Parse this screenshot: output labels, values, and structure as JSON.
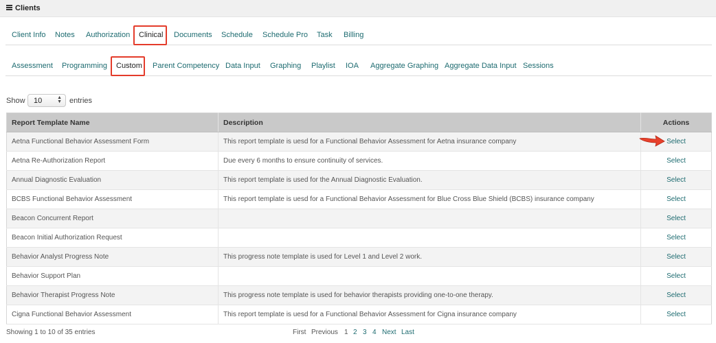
{
  "header": {
    "title": "Clients",
    "menu_icon": "hamburger-icon"
  },
  "main_tabs": [
    {
      "label": "Client Info"
    },
    {
      "label": "Notes"
    },
    {
      "label": "Authorization"
    },
    {
      "label": "Clinical",
      "active": true
    },
    {
      "label": "Documents"
    },
    {
      "label": "Schedule"
    },
    {
      "label": "Schedule Pro"
    },
    {
      "label": "Task"
    },
    {
      "label": "Billing"
    }
  ],
  "sub_tabs": [
    {
      "label": "Assessment"
    },
    {
      "label": "Programming"
    },
    {
      "label": "Custom",
      "active": true
    },
    {
      "label": "Parent Competency"
    },
    {
      "label": "Data Input"
    },
    {
      "label": "Graphing"
    },
    {
      "label": "Playlist"
    },
    {
      "label": "IOA"
    },
    {
      "label": "Aggregate Graphing"
    },
    {
      "label": "Aggregate Data Input"
    },
    {
      "label": "Sessions"
    }
  ],
  "length_control": {
    "show_label": "Show",
    "value": "10",
    "entries_label": "entries"
  },
  "table": {
    "columns": [
      "Report Template Name",
      "Description",
      "Actions"
    ],
    "rows": [
      {
        "name": "Aetna Functional Behavior Assessment Form",
        "description": "This report template is uesd for a Functional Behavior Assessment for Aetna insurance company",
        "action": "Select"
      },
      {
        "name": "Aetna Re-Authorization Report",
        "description": "Due every 6 months to ensure continuity of services.",
        "action": "Select"
      },
      {
        "name": "Annual Diagnostic Evaluation",
        "description": "This report template is used for the Annual Diagnostic Evaluation.",
        "action": "Select"
      },
      {
        "name": "BCBS Functional Behavior Assessment",
        "description": "This report template is uesd for a Functional Behavior Assessment for Blue Cross Blue Shield (BCBS) insurance company",
        "action": "Select"
      },
      {
        "name": "Beacon Concurrent Report",
        "description": "",
        "action": "Select"
      },
      {
        "name": "Beacon Initial Authorization Request",
        "description": "",
        "action": "Select"
      },
      {
        "name": "Behavior Analyst Progress Note",
        "description": "This progress note template is used for Level 1 and Level 2 work.",
        "action": "Select"
      },
      {
        "name": "Behavior Support Plan",
        "description": "",
        "action": "Select"
      },
      {
        "name": "Behavior Therapist Progress Note",
        "description": "This progress note template is used for behavior therapists providing one-to-one therapy.",
        "action": "Select"
      },
      {
        "name": "Cigna Functional Behavior Assessment",
        "description": "This report template is uesd for a Functional Behavior Assessment for Cigna insurance company",
        "action": "Select"
      }
    ]
  },
  "footer": {
    "info": "Showing 1 to 10 of 35 entries",
    "pagination": {
      "first": "First",
      "previous": "Previous",
      "pages": [
        "1",
        "2",
        "3",
        "4"
      ],
      "current": "1",
      "next": "Next",
      "last": "Last"
    }
  },
  "colors": {
    "link": "#1d6b70",
    "highlight": "#e43b2a",
    "header_bg": "#c9c9c9"
  }
}
